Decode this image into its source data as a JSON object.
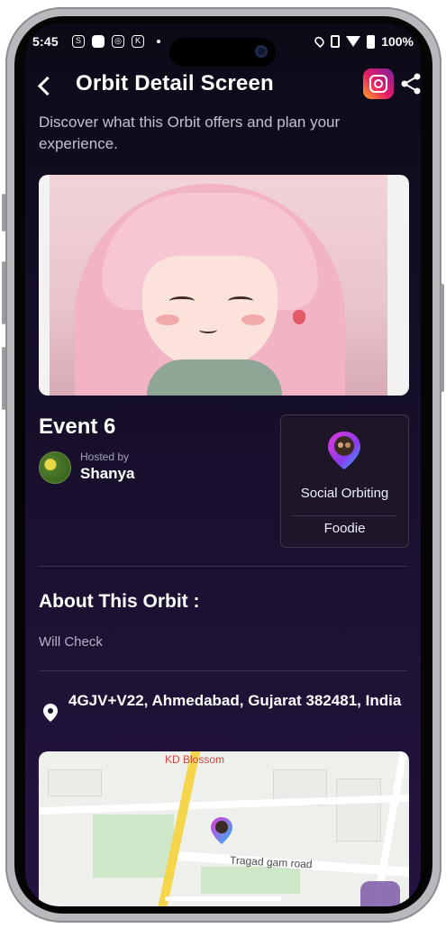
{
  "status_bar": {
    "time": "5:45",
    "battery": "100%",
    "icons": [
      "s-icon",
      "app-icon",
      "instagram-icon",
      "app-icon",
      "dot-icon",
      "location-icon",
      "vibrate-icon",
      "wifi-icon",
      "battery-icon"
    ]
  },
  "header": {
    "title": "Orbit Detail Screen",
    "back_icon": "back-arrow-icon",
    "instagram_icon": "instagram-icon",
    "share_icon": "share-icon"
  },
  "subtitle": "Discover what this Orbit offers and plan your experience.",
  "event": {
    "title": "Event 6",
    "hosted_by_label": "Hosted by",
    "host_name": "Shanya"
  },
  "orbit_card": {
    "category": "Social Orbiting",
    "tag": "Foodie"
  },
  "about": {
    "title": "About This Orbit :",
    "text": "Will Check"
  },
  "location": {
    "address": "4GJV+V22, Ahmedabad, Gujarat 382481, India"
  },
  "map": {
    "labels": [
      "KD Blossom",
      "Tragad gam road"
    ]
  },
  "colors": {
    "background_top": "#0d0a17",
    "background_bottom": "#241440",
    "accent_pin": "#c33bd8",
    "text_muted": "#b8b3c8"
  }
}
